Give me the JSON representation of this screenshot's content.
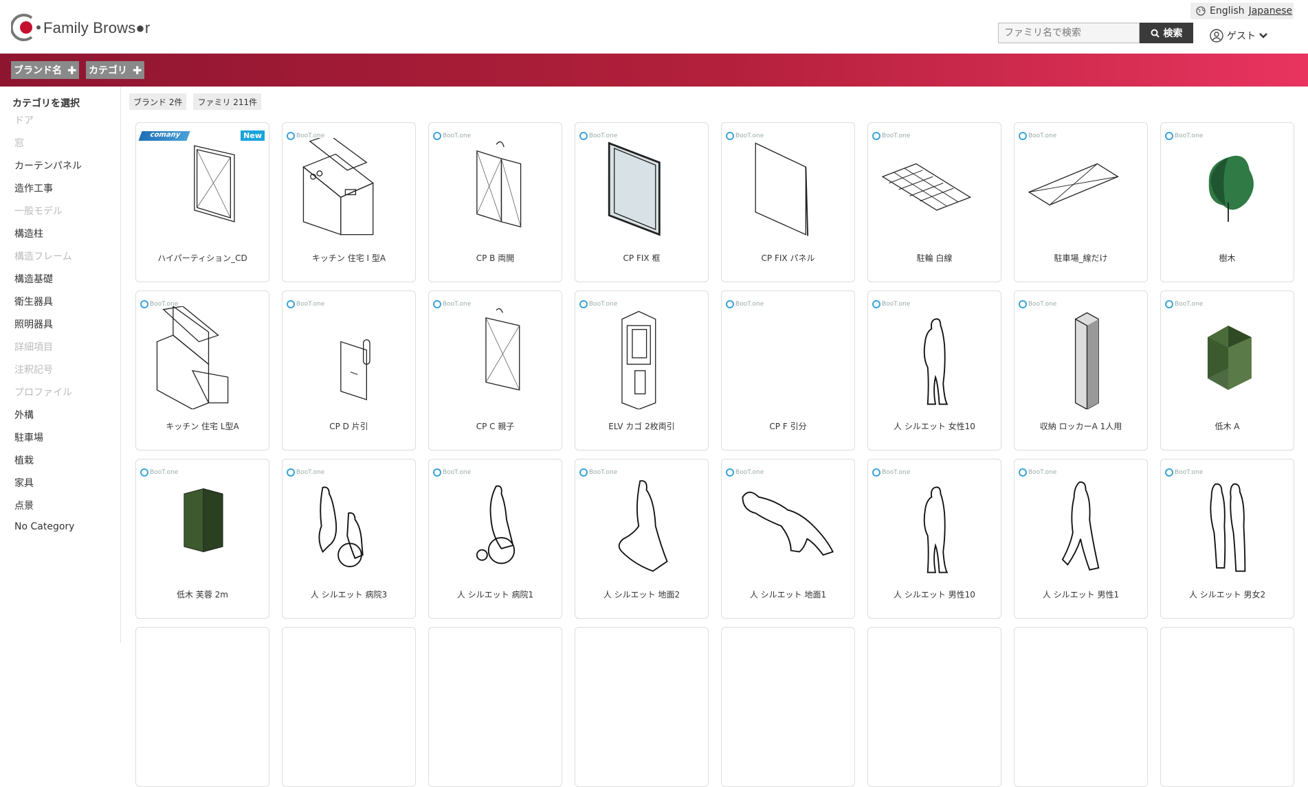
{
  "header": {
    "logo_text": "Family Brows●r",
    "lang_english": "English",
    "lang_japanese": "Japanese",
    "search_placeholder": "ファミリ名で検索",
    "search_button": "検索",
    "user_label": "ゲスト"
  },
  "filters": {
    "brand_button": "ブランド名",
    "category_button": "カテゴリ"
  },
  "sidebar": {
    "heading": "カテゴリを選択",
    "items": [
      {
        "label": "ドア",
        "enabled": false
      },
      {
        "label": "窓",
        "enabled": false
      },
      {
        "label": "カーテンパネル",
        "enabled": true
      },
      {
        "label": "造作工事",
        "enabled": true
      },
      {
        "label": "一般モデル",
        "enabled": false
      },
      {
        "label": "構造柱",
        "enabled": true
      },
      {
        "label": "構造フレーム",
        "enabled": false
      },
      {
        "label": "構造基礎",
        "enabled": true
      },
      {
        "label": "衛生器具",
        "enabled": true
      },
      {
        "label": "照明器具",
        "enabled": true
      },
      {
        "label": "詳細項目",
        "enabled": false
      },
      {
        "label": "注釈記号",
        "enabled": false
      },
      {
        "label": "プロファイル",
        "enabled": false
      },
      {
        "label": "外構",
        "enabled": true
      },
      {
        "label": "駐車場",
        "enabled": true
      },
      {
        "label": "植栽",
        "enabled": true
      },
      {
        "label": "家具",
        "enabled": true
      },
      {
        "label": "点景",
        "enabled": true
      },
      {
        "label": "No Category",
        "enabled": true
      }
    ]
  },
  "counts": {
    "brand": "ブランド 2件",
    "family": "ファミリ 211件"
  },
  "cards": [
    {
      "label": "ハイパーティション_CD",
      "brand": "comany",
      "new": "New",
      "icon": "door-panel"
    },
    {
      "label": "キッチン 住宅 I 型A",
      "brand": "BooT.one",
      "icon": "kitchen-i"
    },
    {
      "label": "CP B 両開",
      "brand": "BooT.one",
      "icon": "double-door"
    },
    {
      "label": "CP FIX 框",
      "brand": "BooT.one",
      "icon": "fix-frame"
    },
    {
      "label": "CP FIX パネル",
      "brand": "BooT.one",
      "icon": "fix-panel"
    },
    {
      "label": "駐輪 白線",
      "brand": "BooT.one",
      "icon": "bike-lines"
    },
    {
      "label": "駐車場_線だけ",
      "brand": "BooT.one",
      "icon": "parking-lines"
    },
    {
      "label": "樹木",
      "brand": "BooT.one",
      "icon": "tree"
    },
    {
      "label": "キッチン 住宅 L型A",
      "brand": "BooT.one",
      "icon": "kitchen-l"
    },
    {
      "label": "CP D 片引",
      "brand": "BooT.one",
      "icon": "sliding-door"
    },
    {
      "label": "CP C 親子",
      "brand": "BooT.one",
      "icon": "parent-door"
    },
    {
      "label": "ELV カゴ 2枚両引",
      "brand": "BooT.one",
      "icon": "elevator"
    },
    {
      "label": "CP F 引分",
      "brand": "BooT.one",
      "icon": "empty"
    },
    {
      "label": "人 シルエット 女性10",
      "brand": "BooT.one",
      "icon": "person"
    },
    {
      "label": "収納 ロッカーA 1人用",
      "brand": "BooT.one",
      "icon": "locker"
    },
    {
      "label": "低木 A",
      "brand": "BooT.one",
      "icon": "shrub"
    },
    {
      "label": "低木 芙蓉 2m",
      "brand": "BooT.one",
      "icon": "shrub2"
    },
    {
      "label": "人 シルエット 病院3",
      "brand": "BooT.one",
      "icon": "wheelchair-push"
    },
    {
      "label": "人 シルエット 病院1",
      "brand": "BooT.one",
      "icon": "wheelchair"
    },
    {
      "label": "人 シルエット 地面2",
      "brand": "BooT.one",
      "icon": "sitting"
    },
    {
      "label": "人 シルエット 地面1",
      "brand": "BooT.one",
      "icon": "lying"
    },
    {
      "label": "人 シルエット 男性10",
      "brand": "BooT.one",
      "icon": "person"
    },
    {
      "label": "人 シルエット 男性1",
      "brand": "BooT.one",
      "icon": "walking"
    },
    {
      "label": "人 シルエット 男女2",
      "brand": "BooT.one",
      "icon": "couple"
    }
  ]
}
